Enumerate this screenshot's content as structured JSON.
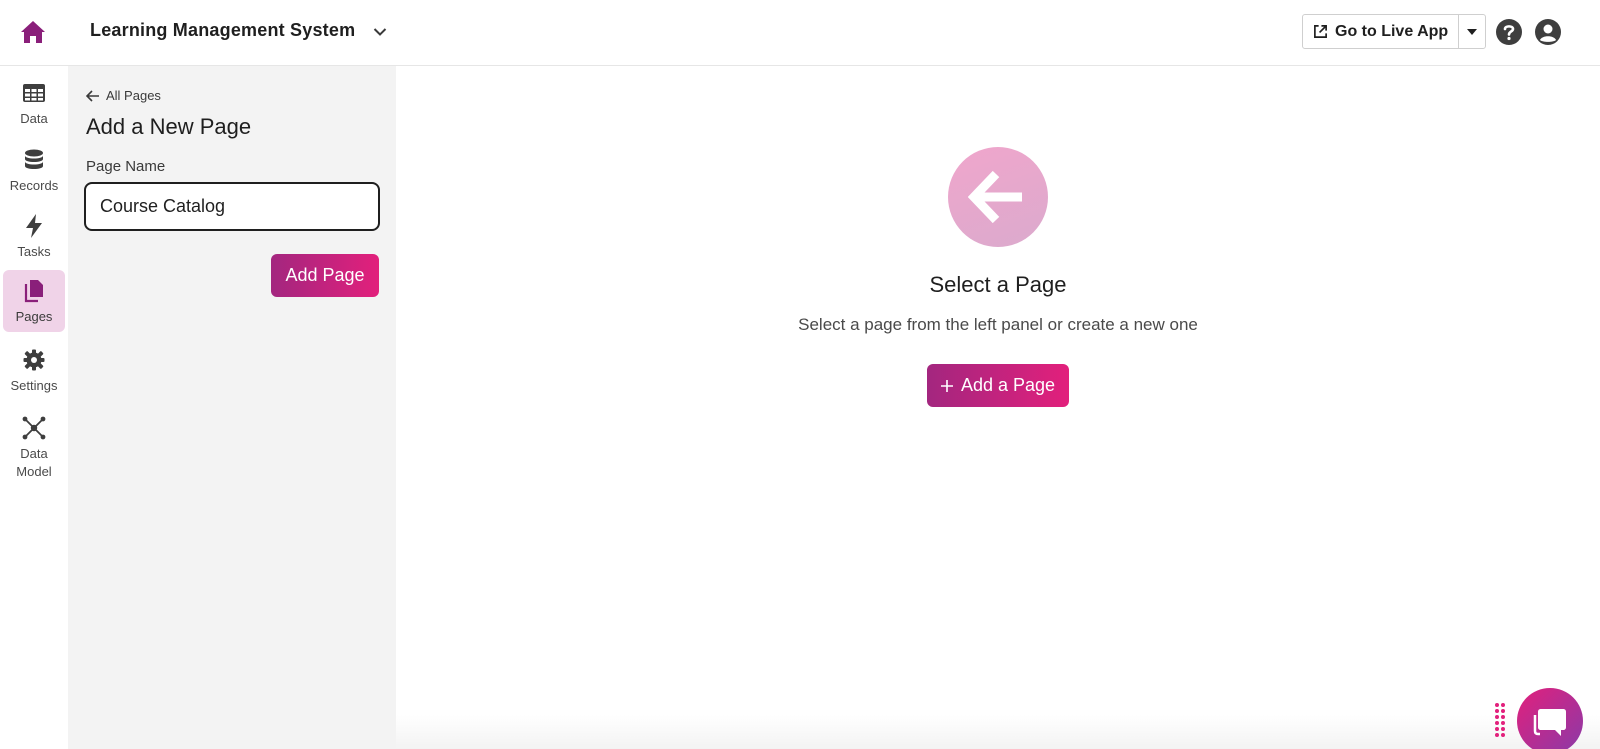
{
  "header": {
    "app_title": "Learning Management System",
    "live_app_label": "Go to Live App"
  },
  "rail": {
    "items": [
      {
        "label": "Data",
        "icon": "table-icon"
      },
      {
        "label": "Records",
        "icon": "database-icon"
      },
      {
        "label": "Tasks",
        "icon": "bolt-icon"
      },
      {
        "label": "Pages",
        "icon": "pages-icon",
        "active": true
      },
      {
        "label": "Settings",
        "icon": "gear-icon"
      },
      {
        "label": "Data\nModel",
        "icon": "network-icon"
      }
    ]
  },
  "panel": {
    "back_label": "All Pages",
    "title": "Add a New Page",
    "field_label": "Page Name",
    "page_name_value": "Course Catalog",
    "submit_label": "Add Page"
  },
  "main": {
    "empty_title": "Select a Page",
    "empty_subtitle": "Select a page from the left panel or create a new one",
    "add_button_label": "Add a Page"
  },
  "colors": {
    "accent_start": "#a3267f",
    "accent_end": "#e2207c",
    "active_rail_bg": "#f0d3e8",
    "home_icon": "#8a1f7a"
  }
}
